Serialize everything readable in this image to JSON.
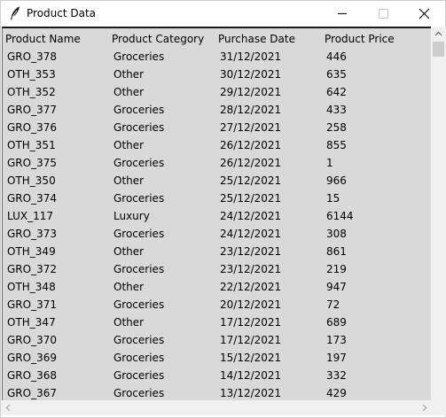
{
  "window": {
    "title": "Product Data",
    "icon": "feather-icon"
  },
  "table": {
    "headers": [
      "Product Name",
      "Product Category",
      "Purchase Date",
      "Product Price"
    ],
    "rows": [
      [
        "GRO_378",
        "Groceries",
        "31/12/2021",
        "446"
      ],
      [
        "OTH_353",
        "Other",
        "30/12/2021",
        "635"
      ],
      [
        "OTH_352",
        "Other",
        "29/12/2021",
        "642"
      ],
      [
        "GRO_377",
        "Groceries",
        "28/12/2021",
        "433"
      ],
      [
        "GRO_376",
        "Groceries",
        "27/12/2021",
        "258"
      ],
      [
        "OTH_351",
        "Other",
        "26/12/2021",
        "855"
      ],
      [
        "GRO_375",
        "Groceries",
        "26/12/2021",
        "1"
      ],
      [
        "OTH_350",
        "Other",
        "25/12/2021",
        "966"
      ],
      [
        "GRO_374",
        "Groceries",
        "25/12/2021",
        "15"
      ],
      [
        "LUX_117",
        "Luxury",
        "24/12/2021",
        "6144"
      ],
      [
        "GRO_373",
        "Groceries",
        "24/12/2021",
        "308"
      ],
      [
        "OTH_349",
        "Other",
        "23/12/2021",
        "861"
      ],
      [
        "GRO_372",
        "Groceries",
        "23/12/2021",
        "219"
      ],
      [
        "OTH_348",
        "Other",
        "22/12/2021",
        "947"
      ],
      [
        "GRO_371",
        "Groceries",
        "20/12/2021",
        "72"
      ],
      [
        "OTH_347",
        "Other",
        "17/12/2021",
        "689"
      ],
      [
        "GRO_370",
        "Groceries",
        "17/12/2021",
        "173"
      ],
      [
        "GRO_369",
        "Groceries",
        "15/12/2021",
        "197"
      ],
      [
        "GRO_368",
        "Groceries",
        "14/12/2021",
        "332"
      ],
      [
        "GRO_367",
        "Groceries",
        "13/12/2021",
        "429"
      ]
    ]
  },
  "colors": {
    "table_background": "#d9d9d9",
    "scrollbar_track": "#f0f0f0",
    "scrollbar_thumb": "#cdcdcd"
  },
  "scroll": {
    "vertical_position": 0
  }
}
